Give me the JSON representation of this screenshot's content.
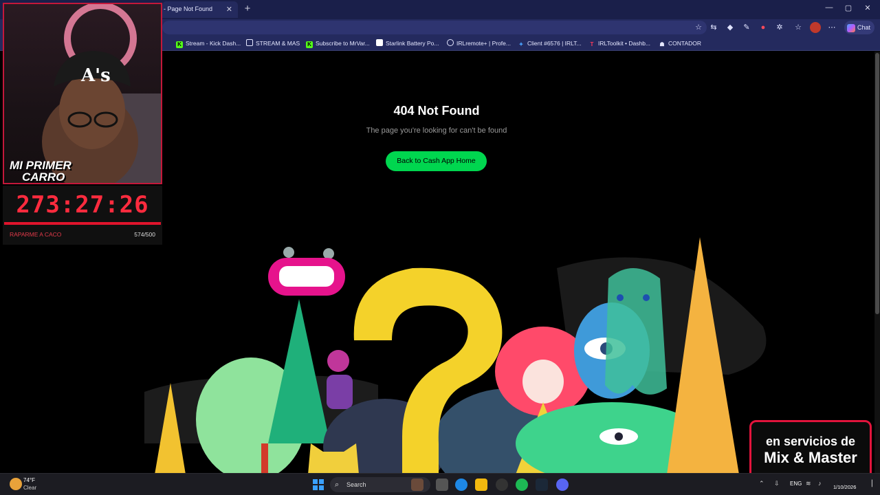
{
  "browser": {
    "tab_title": "- Page Not Found",
    "tab_close": "✕",
    "new_tab": "+",
    "window_controls": [
      "—",
      "▢",
      "✕"
    ],
    "chat_label": "Chat",
    "bookmarks": [
      {
        "label": "Stream - Kick Dash...",
        "icon": "kick-icon",
        "icon_color": "#53fc18"
      },
      {
        "label": "STREAM & MAS",
        "icon": "folder-icon",
        "icon_color": "#e6e8ff"
      },
      {
        "label": "Subscribe to MrVar...",
        "icon": "kick-icon",
        "icon_color": "#53fc18"
      },
      {
        "label": "Starlink Battery Po...",
        "icon": "doc-icon",
        "icon_color": "#ffffff"
      },
      {
        "label": "IRLremote+ | Profe...",
        "icon": "globe-icon",
        "icon_color": "#e6e8ff"
      },
      {
        "label": "Client #6576 | IRLT...",
        "icon": "client-icon",
        "icon_color": "#4aa3ff"
      },
      {
        "label": "IRLToolkit • Dashb...",
        "icon": "irltoolkit-icon",
        "icon_color": "#ff3a5a"
      },
      {
        "label": "CONTADOR",
        "icon": "contador-icon",
        "icon_color": "#e6e8ff"
      }
    ]
  },
  "page": {
    "title": "404 Not Found",
    "subtitle": "The page you're looking for can't be found",
    "button_label": "Back to Cash App Home",
    "accent": "#00d64f"
  },
  "overlay": {
    "cam_label_line1": "MI PRIMER",
    "cam_label_line2": "CARRO",
    "timer": "273:27:26",
    "goal_label": "RAPARME A CACO",
    "goal_count": "574/500",
    "goal_progress": 1.0,
    "promo_line1": "en servicios de",
    "promo_line2": "Mix & Master"
  },
  "taskbar": {
    "temperature": "74°F",
    "condition": "Clear",
    "search_label": "Search",
    "language": "ENG",
    "date": "1/10/2026"
  }
}
